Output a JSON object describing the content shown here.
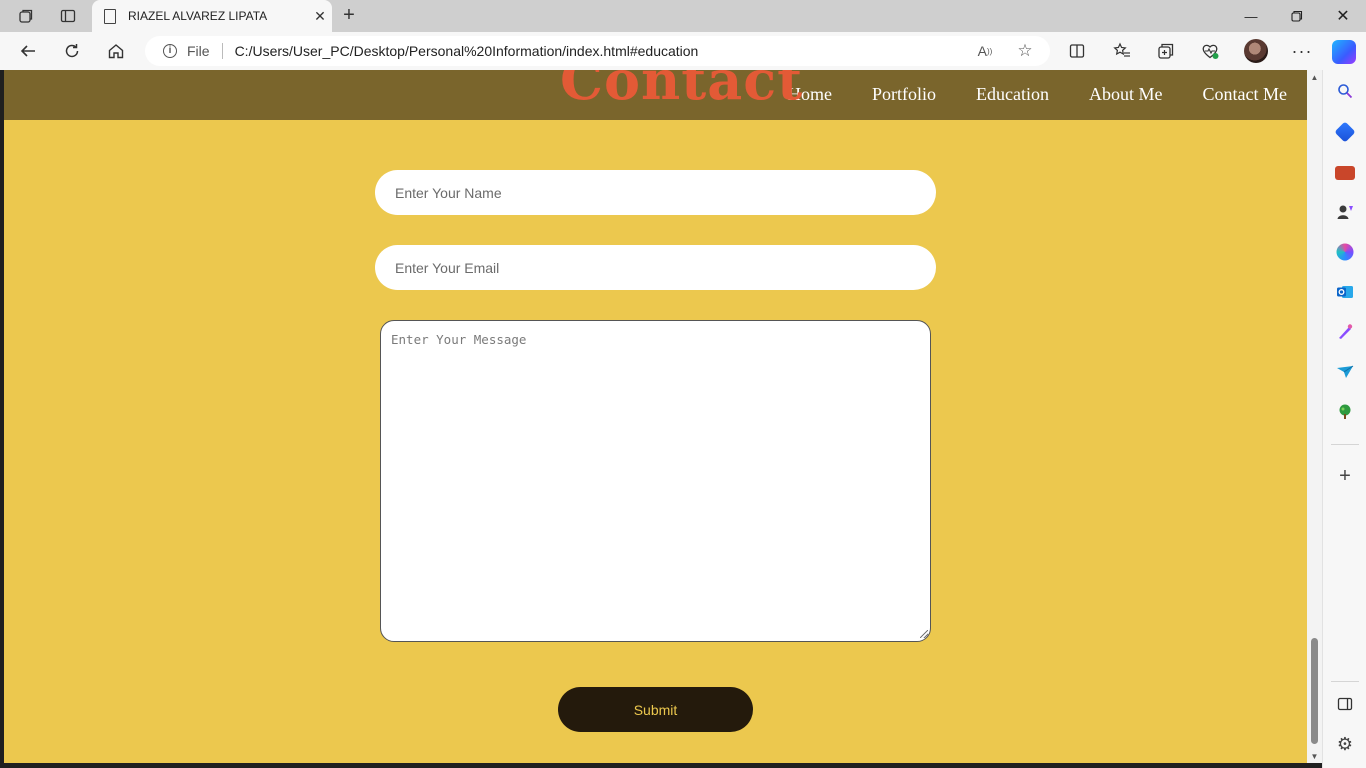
{
  "browser": {
    "tab_title": "RIAZEL ALVAREZ LIPATA",
    "address_prefix": "File",
    "address_url": "C:/Users/User_PC/Desktop/Personal%20Information/index.html#education"
  },
  "site": {
    "section_heading": "Contact",
    "nav": [
      "Home",
      "Portfolio",
      "Education",
      "About Me",
      "Contact Me"
    ],
    "colors": {
      "header_bg": "#7a652c",
      "page_bg": "#ecc84e",
      "heading": "#e35a36",
      "button_bg": "#241a0c",
      "button_text": "#ecc84e"
    }
  },
  "form": {
    "name_placeholder": "Enter Your Name",
    "email_placeholder": "Enter Your Email",
    "message_placeholder": "Enter Your Message",
    "submit_label": "Submit"
  },
  "icons": {
    "tabbar": [
      "workspaces-icon",
      "tab-actions-icon",
      "document-icon",
      "close-icon",
      "new-tab-icon"
    ],
    "window": [
      "minimize-icon",
      "restore-icon",
      "close-window-icon"
    ],
    "toolbar": [
      "back-icon",
      "refresh-icon",
      "home-icon",
      "info-icon",
      "read-aloud-icon",
      "favorite-star-icon",
      "split-screen-icon",
      "favorites-icon",
      "collections-icon",
      "browser-essentials-icon",
      "profile-avatar",
      "more-icon",
      "copilot-icon"
    ],
    "sidebar": [
      "search-icon",
      "shopping-icon",
      "tools-icon",
      "games-icon",
      "microsoft-365-icon",
      "outlook-icon",
      "designer-icon",
      "send-icon",
      "tree-icon",
      "add-icon",
      "sidebar-toggle-icon",
      "settings-icon"
    ]
  }
}
